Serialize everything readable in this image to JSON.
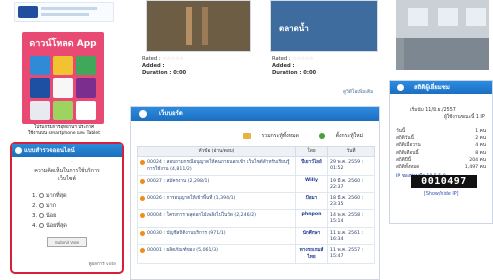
{
  "left": {
    "app_box_title": "ดาวน์โหลด App",
    "app_caption": "โปรแกรมการอุทยานฯ ประกาศ\nใช้งานบน smartphone และ Tablet",
    "vote": {
      "title": "แบบสำรวจออนไลน์",
      "question": "ความคิดเห็นในการใช้บริการ\nเว็บไซต์",
      "options": [
        "มากที่สุด",
        "มาก",
        "น้อย",
        "น้อยที่สุด"
      ],
      "submit_label": "Submit Vote",
      "results_label": "ดูผลการ vote"
    }
  },
  "middle": {
    "videos": [
      {
        "title": "",
        "rated": "Rated :",
        "added": "Added :",
        "duration": "Duration : 0:00"
      },
      {
        "title": "ตลาดน้ำ",
        "rated": "Rated :",
        "added": "Added :",
        "duration": "Duration : 0:00"
      }
    ],
    "video_more": "ดูวิดีโอเพิ่มเติม",
    "forum": {
      "title": "เว็บบอร์ด",
      "actions": [
        "รวมกระทู้ทั้งหมด",
        "ตั้งกระทู้ใหม่"
      ],
      "headers": [
        "หัวข้อ (อ่าน/ตอบ)",
        "โดย",
        "วันที่"
      ],
      "rows": [
        {
          "topic": "00024 : สอบถามกรณีอนุญาตให้คนภายนอกเข้า เว็บไซต์สำหรับเรียนรู้การใช้งาน (4,811/2)",
          "author": "ปีเยาว์ไอย์",
          "date": "29 พ.ค. 2559 : 01:52"
        },
        {
          "topic": "00027 : สมัครงาน (2,298/1)",
          "author": "Willy",
          "date": "19 มี.ค. 2560 : 22:37"
        },
        {
          "topic": "00026 : การอนุญาตให้เข้าพื้นที่ (1,394/1)",
          "author": "ป้อมา",
          "date": "18 มี.ค. 2560 : 23:35"
        },
        {
          "topic": "00004 : โครงการ พลุดอกไม้เพลิงไปในวัด (2,246/2)",
          "author": "phnpon",
          "date": "14 พ.ค. 2558 : 15:14"
        },
        {
          "topic": "00030 : บัญชีสถิติงานบริการ (971/1)",
          "author": "นักศึกษา",
          "date": "11 ม.ค. 2561 : 16:34"
        },
        {
          "topic": "00001 : ผลิตภัณฑ์ของ (5,061/3)",
          "author": "ทางรถเกมส์ไทย",
          "date": "11 พ.ค. 2557 : 15:47"
        }
      ]
    }
  },
  "right": {
    "stats": {
      "title": "สถิติผู้เยี่ยมชม",
      "date": "เริ่มนับ 11/มิ.ย./2557",
      "user_label": "ผู้ใช้งานขณะนี้ 1 IP",
      "lines": [
        {
          "label": "วันนี้",
          "value": "1 คน"
        },
        {
          "label": "สถิติวันนี้",
          "value": "2 คน"
        },
        {
          "label": "สถิติเมื่อวาน",
          "value": "4 คน"
        },
        {
          "label": "สถิติเดือนนี้",
          "value": "8 คน"
        },
        {
          "label": "สถิติปีนี้",
          "value": "204 คน"
        },
        {
          "label": "สถิติทั้งหมด",
          "value": "1,497 คน"
        }
      ],
      "ip_label": "IP ของท่านคือ 18.5.5.9",
      "counter": "0010497",
      "show_ip": "[Show/hide IP]"
    }
  }
}
